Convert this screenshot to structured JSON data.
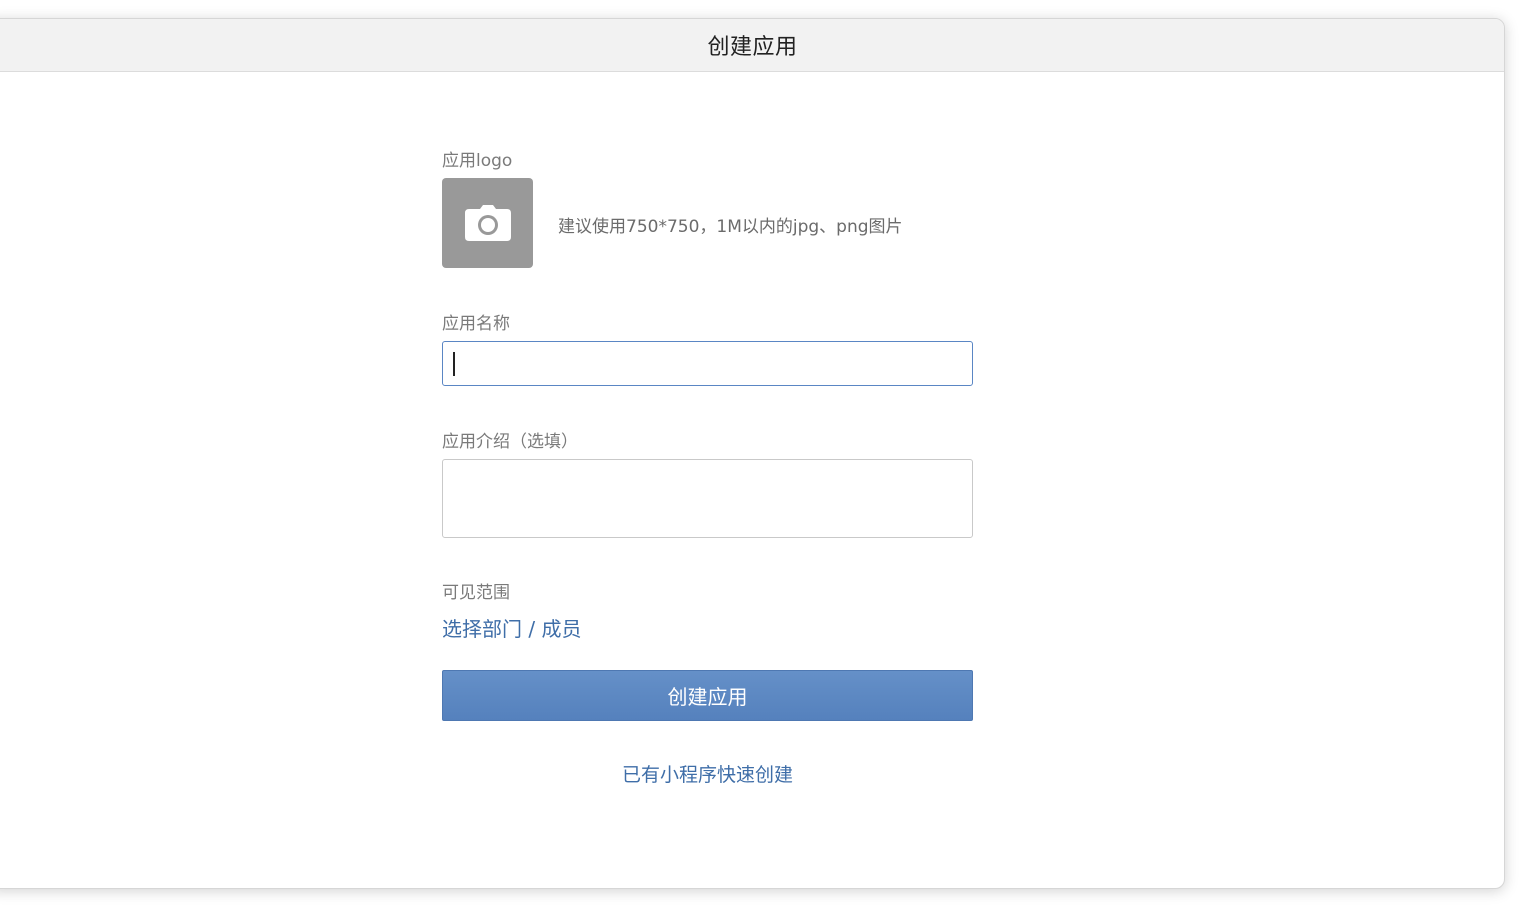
{
  "dialog": {
    "title": "创建应用"
  },
  "form": {
    "logo": {
      "label": "应用logo",
      "hint": "建议使用750*750，1M以内的jpg、png图片"
    },
    "name": {
      "label": "应用名称",
      "value": ""
    },
    "description": {
      "label": "应用介绍（选填）",
      "value": ""
    },
    "scope": {
      "label": "可见范围",
      "link": "选择部门 / 成员"
    },
    "submit_label": "创建应用",
    "quick_create_link": "已有小程序快速创建"
  },
  "colors": {
    "accent": "#5a86c4",
    "link": "#3f6ea8",
    "upload_bg": "#999999"
  }
}
